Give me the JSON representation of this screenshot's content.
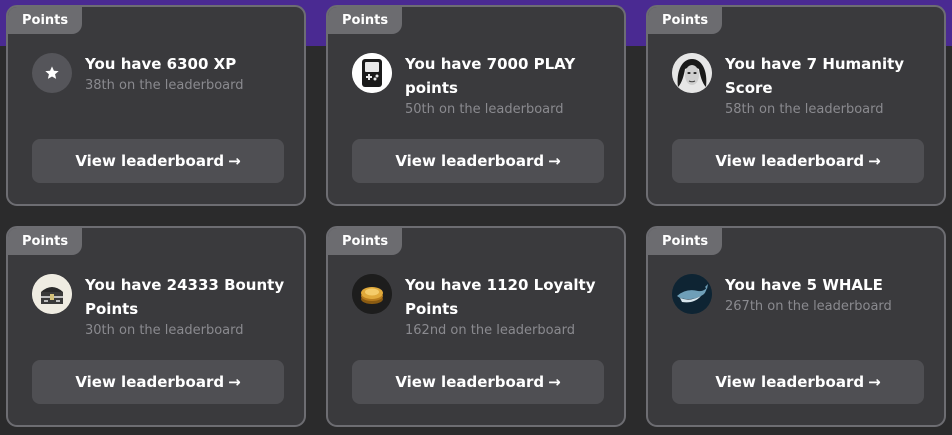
{
  "tag_label": "Points",
  "button_label": "View leaderboard",
  "button_arrow": "→",
  "cards": [
    {
      "title": "You have 6300 XP",
      "rank": "38th on the leaderboard",
      "icon": "star-icon"
    },
    {
      "title": "You have 7000 PLAY points",
      "rank": "50th on the leaderboard",
      "icon": "gameboy-icon"
    },
    {
      "title": "You have 7 Humanity Score",
      "rank": "58th on the leaderboard",
      "icon": "face-avatar-icon"
    },
    {
      "title": "You have 24333 Bounty Points",
      "rank": "30th on the leaderboard",
      "icon": "treasure-chest-icon"
    },
    {
      "title": "You have 1120 Loyalty Points",
      "rank": "162nd on the leaderboard",
      "icon": "gold-coins-icon"
    },
    {
      "title": "You have 5 WHALE",
      "rank": "267th on the leaderboard",
      "icon": "whale-icon"
    }
  ],
  "colors": {
    "background": "#2b2b2c",
    "card": "#3a3a3d",
    "accent_band": "#4a2a92",
    "button": "#4f4f53"
  }
}
